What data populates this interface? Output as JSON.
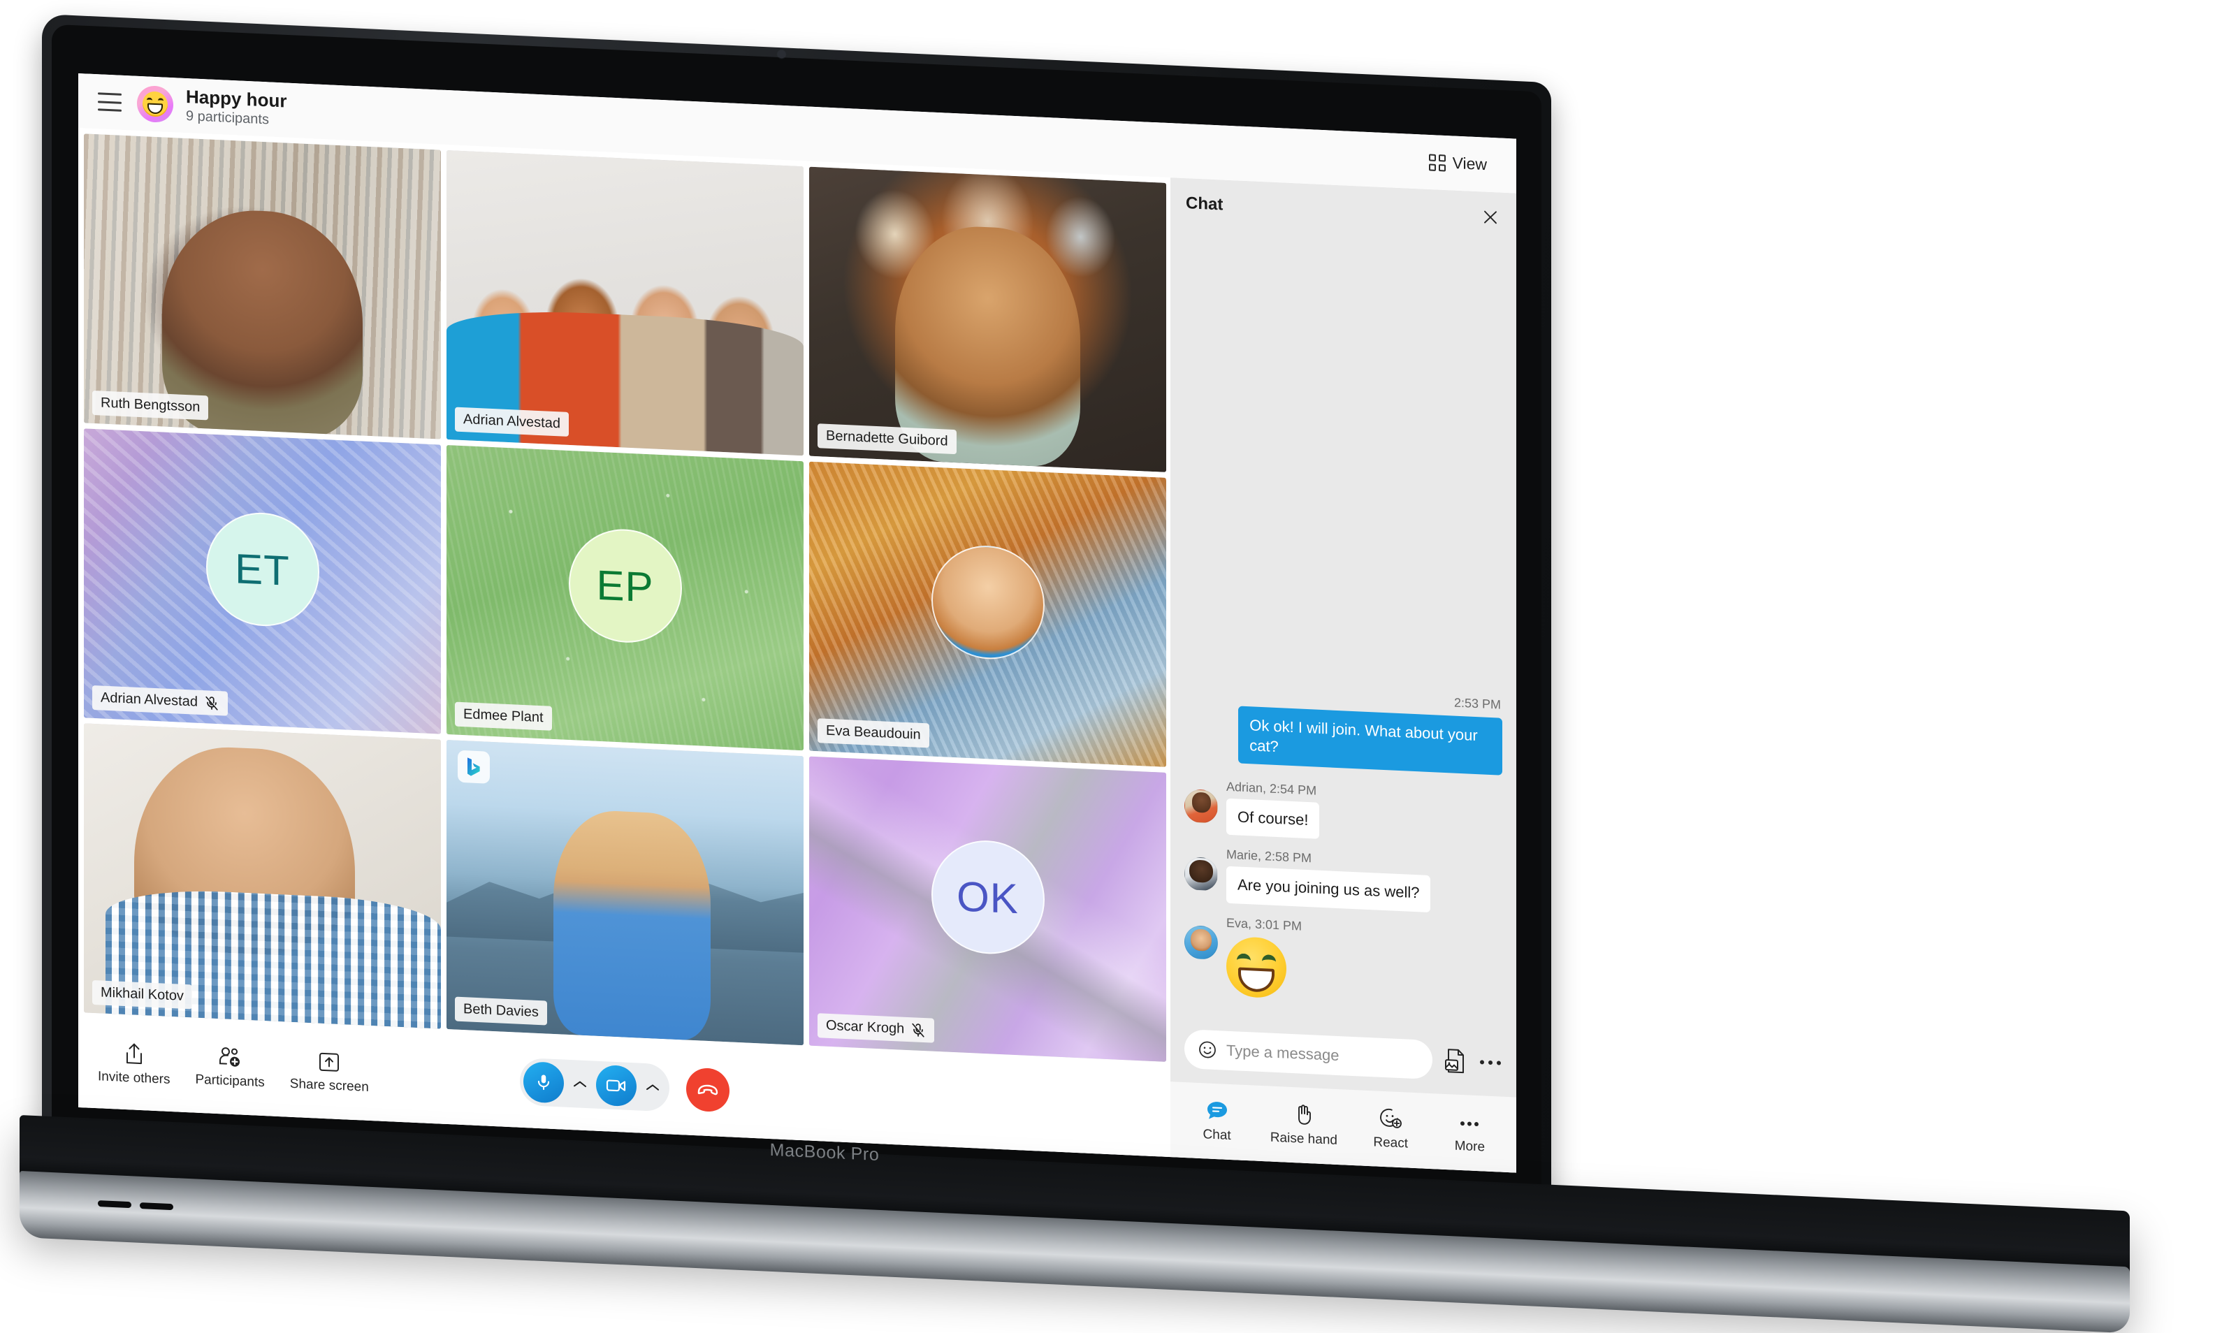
{
  "device": {
    "brand_label": "MacBook Pro"
  },
  "header": {
    "menu_icon": "hamburger-icon",
    "avatar_icon": "smiley-avatar",
    "title": "Happy hour",
    "subtitle": "9 participants",
    "view_button": {
      "label": "View",
      "icon": "grid-view-icon"
    }
  },
  "grid": {
    "tiles": [
      {
        "name": "Ruth Bengtsson",
        "muted": false,
        "type": "video",
        "bg": "bg-ruth"
      },
      {
        "name": "Adrian Alvestad",
        "muted": false,
        "type": "video",
        "bg": "bg-adrian"
      },
      {
        "name": "Bernadette Guibord",
        "muted": false,
        "type": "video",
        "bg": "bg-bern"
      },
      {
        "name": "Adrian Alvestad",
        "muted": true,
        "type": "initials",
        "bg": "bg-et",
        "initials": "ET",
        "initials_color": "#0f6e72",
        "initials_bg": "#d6f5ec"
      },
      {
        "name": "Edmee Plant",
        "muted": false,
        "type": "initials",
        "bg": "bg-ep",
        "initials": "EP",
        "initials_color": "#0b7a33",
        "initials_bg": "#e3f5c4"
      },
      {
        "name": "Eva Beaudouin",
        "muted": false,
        "type": "photo",
        "bg": "bg-eva"
      },
      {
        "name": "Mikhail Kotov",
        "muted": false,
        "type": "video",
        "bg": "bg-mikhail"
      },
      {
        "name": "Beth Davies",
        "muted": false,
        "type": "video",
        "bg": "bg-beth",
        "badge": "bing-logo-icon"
      },
      {
        "name": "Oscar Krogh",
        "muted": true,
        "type": "initials",
        "bg": "bg-ok",
        "initials": "OK",
        "initials_color": "#4a55c4",
        "initials_bg": "#e5eafb"
      }
    ]
  },
  "call_controls": {
    "actions": [
      {
        "label": "Invite others",
        "icon": "share-up-icon"
      },
      {
        "label": "Participants",
        "icon": "add-people-icon"
      },
      {
        "label": "Share screen",
        "icon": "screen-share-icon"
      }
    ],
    "mic": {
      "icon": "microphone-icon",
      "chevron": "chevron-up-icon"
    },
    "video": {
      "icon": "video-camera-icon",
      "chevron": "chevron-up-icon"
    },
    "hangup": {
      "icon": "end-call-icon"
    },
    "accent_blue": "#1a96e0",
    "hangup_red": "#f0412f"
  },
  "chat": {
    "title": "Chat",
    "close_icon": "close-icon",
    "outgoing": {
      "time": "2:53 PM",
      "text": "Ok ok! I will join. What about your cat?"
    },
    "messages": [
      {
        "meta": "Adrian, 2:54 PM",
        "text": "Of course!",
        "avatar": "av-adrian",
        "kind": "text"
      },
      {
        "meta": "Marie, 2:58 PM",
        "text": "Are you joining us as well?",
        "avatar": "av-marie",
        "kind": "text"
      },
      {
        "meta": "Eva, 3:01 PM",
        "text": "",
        "avatar": "av-eva",
        "kind": "emoji"
      }
    ],
    "composer": {
      "emoji_icon": "smiley-icon",
      "placeholder": "Type a message",
      "value": "",
      "attach_icon": "image-file-icon",
      "more_icon": "ellipsis-icon"
    },
    "tabs": [
      {
        "label": "Chat",
        "icon": "chat-bubble-icon",
        "active": true
      },
      {
        "label": "Raise hand",
        "icon": "raised-hand-icon",
        "active": false
      },
      {
        "label": "React",
        "icon": "add-reaction-icon",
        "active": false
      },
      {
        "label": "More",
        "icon": "ellipsis-icon",
        "active": false
      }
    ],
    "bubble_color": "#1b9ae0"
  }
}
